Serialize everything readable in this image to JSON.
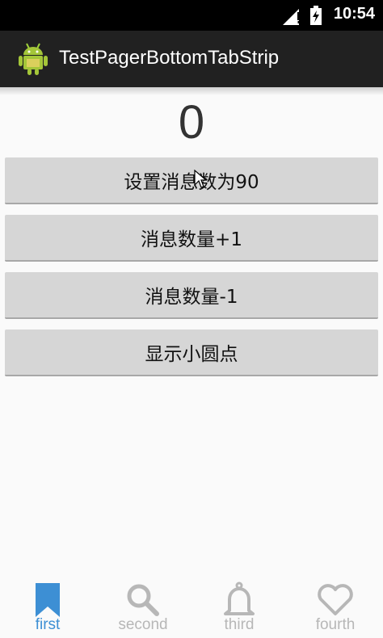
{
  "status_bar": {
    "time": "10:54"
  },
  "action_bar": {
    "title": "TestPagerBottomTabStrip"
  },
  "main": {
    "count": "0",
    "buttons": [
      {
        "label": "设置消息数为90"
      },
      {
        "label": "消息数量+1"
      },
      {
        "label": "消息数量-1"
      },
      {
        "label": "显示小圆点"
      }
    ]
  },
  "tabs": [
    {
      "label": "first",
      "icon": "bookmark-icon",
      "active": true
    },
    {
      "label": "second",
      "icon": "search-icon",
      "active": false
    },
    {
      "label": "third",
      "icon": "bell-icon",
      "active": false
    },
    {
      "label": "fourth",
      "icon": "heart-icon",
      "active": false
    }
  ],
  "colors": {
    "active_tab": "#3d8fd4",
    "inactive_tab": "#b7b7b7",
    "action_bar": "#212121",
    "button": "#d6d6d6"
  }
}
